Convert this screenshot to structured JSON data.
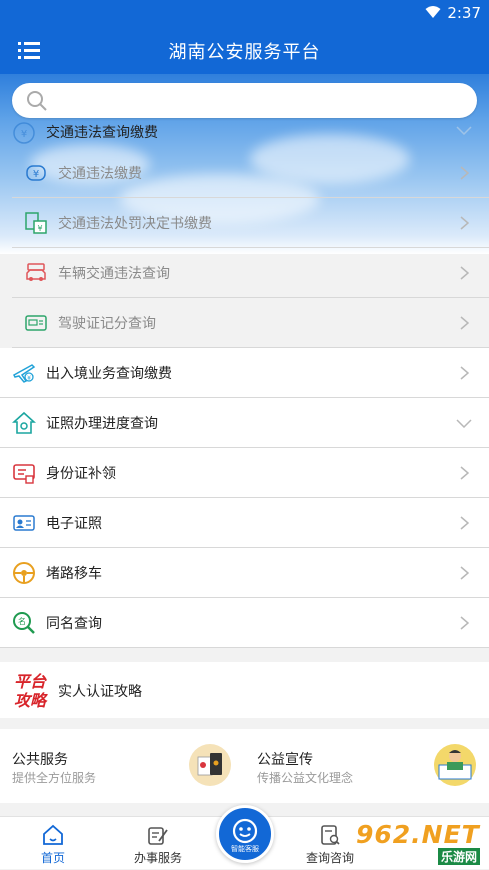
{
  "status_bar": {
    "time": "2:37",
    "wifi_icon": "wifi-icon"
  },
  "app_bar": {
    "title": "湖南公安服务平台",
    "menu_icon": "menu-icon"
  },
  "search": {
    "placeholder": "",
    "value": ""
  },
  "menu": {
    "traffic": {
      "label": "交通违法查询缴费",
      "expanded": true,
      "items": [
        {
          "label": "交通违法缴费",
          "icon": "yuan-icon"
        },
        {
          "label": "交通违法处罚决定书缴费",
          "icon": "document-payment-icon"
        },
        {
          "label": "车辆交通违法查询",
          "icon": "car-icon"
        },
        {
          "label": "驾驶证记分查询",
          "icon": "license-icon"
        }
      ]
    },
    "entries": [
      {
        "label": "出入境业务查询缴费",
        "icon": "plane-icon"
      },
      {
        "label": "证照办理进度查询",
        "icon": "house-icon"
      },
      {
        "label": "身份证补领",
        "icon": "id-card-icon"
      },
      {
        "label": "电子证照",
        "icon": "e-license-icon"
      },
      {
        "label": "堵路移车",
        "icon": "steering-wheel-icon"
      },
      {
        "label": "同名查询",
        "icon": "name-search-icon"
      }
    ]
  },
  "strategy": {
    "logo_line1": "平台",
    "logo_line2": "攻略",
    "label": "实人认证攻略"
  },
  "services": [
    {
      "title": "公共服务",
      "subtitle": "提供全方位服务"
    },
    {
      "title": "公益宣传",
      "subtitle": "传播公益文化理念"
    }
  ],
  "tabs": [
    {
      "label": "首页",
      "active": true
    },
    {
      "label": "办事服务",
      "active": false
    },
    {
      "label": "查询咨询",
      "active": false
    }
  ],
  "assistant": {
    "label": "智能客服"
  },
  "watermark": {
    "brand": "962.NET",
    "sub": "乐游网"
  },
  "colors": {
    "primary": "#1268d6",
    "muted_text": "#8a8a8a",
    "divider": "#d8d8d8"
  }
}
